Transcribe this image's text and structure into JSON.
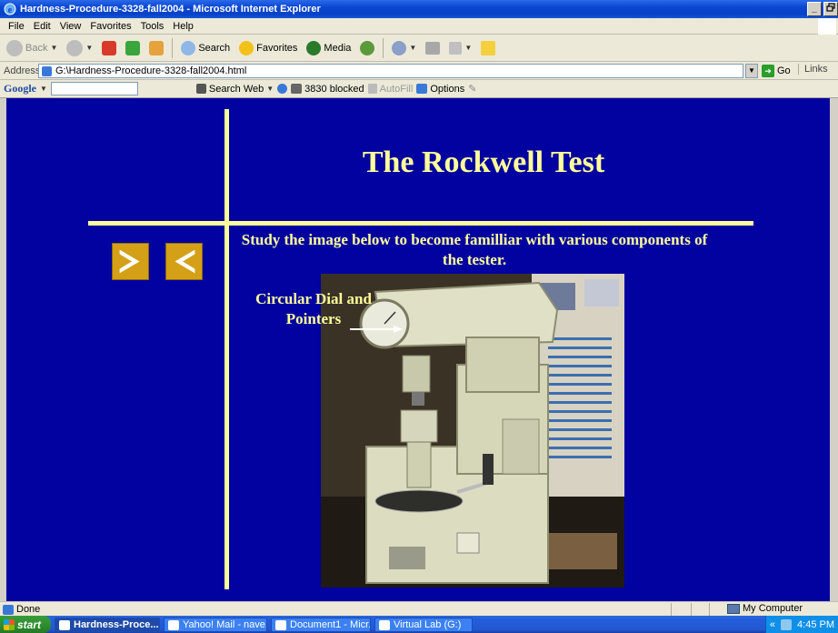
{
  "window": {
    "title": "Hardness-Procedure-3328-fall2004 - Microsoft Internet Explorer",
    "buttons": [
      "_",
      "Ͱ",
      "×"
    ]
  },
  "menubar": {
    "items": [
      "File",
      "Edit",
      "View",
      "Favorites",
      "Tools",
      "Help"
    ]
  },
  "toolbar": {
    "back": "Back",
    "search": "Search",
    "favorites": "Favorites",
    "media": "Media"
  },
  "addressbar": {
    "label": "Address",
    "value": "G:\\Hardness-Procedure-3328-fall2004.html",
    "go": "Go",
    "links": "Links"
  },
  "googlebar": {
    "logo": "Google",
    "search_web": "Search Web",
    "blocked": "3830 blocked",
    "autofill": "AutoFill",
    "options": "Options"
  },
  "page": {
    "title": "The Rockwell Test",
    "instructions": "Study the image below to become familliar with various components of the tester.",
    "dial_label": "Circular Dial and Pointers",
    "colors": {
      "background": "#0202a0",
      "text": "#ffff99",
      "arrow": "#d4a017"
    }
  },
  "statusbar": {
    "text": "Done",
    "zone": "My Computer"
  },
  "taskbar": {
    "start": "start",
    "tasks": [
      "Hardness-Proce...",
      "Yahoo! Mail - nave...",
      "Document1 - Micr...",
      "Virtual Lab (G:)"
    ],
    "clock": "4:45 PM"
  },
  "icons": {
    "next": "next-arrow-icon",
    "previous": "previous-arrow-icon"
  }
}
